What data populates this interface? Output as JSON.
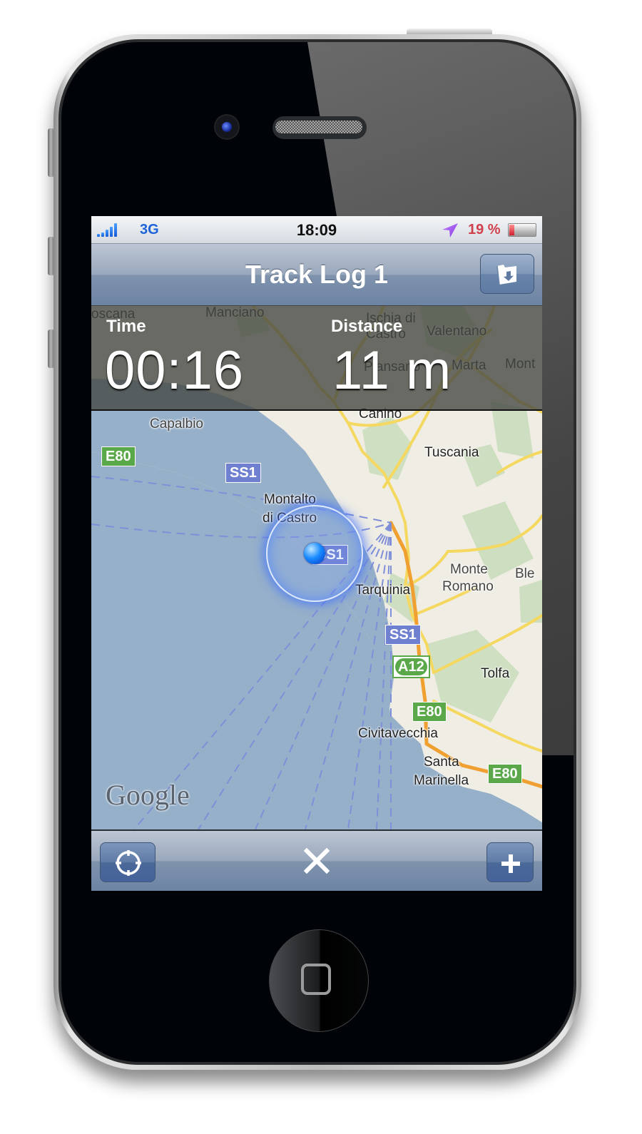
{
  "status_bar": {
    "carrier": "3G",
    "signal_bars": 5,
    "time": "18:09",
    "location_icon": "location-arrow-icon",
    "battery_percent_label": "19 %",
    "battery_level": 0.19
  },
  "nav_bar": {
    "title": "Track Log 1",
    "right_button_icon": "folder-download-icon"
  },
  "info_panel": {
    "time_label": "Time",
    "time_value": "00:16",
    "distance_label": "Distance",
    "distance_value": "11 m"
  },
  "map": {
    "provider_logo": "Google",
    "places": {
      "toscana": "oscana",
      "manciano": "Manciano",
      "ischia": "Ischia di",
      "castro": "Castro",
      "valentano": "Valentano",
      "piansano": "Piansano",
      "marta": "Marta",
      "mont": "Mont",
      "canino": "Canino",
      "capalbio": "Capalbio",
      "tuscania": "Tuscania",
      "montalto": "Montalto",
      "di_castro": "di Castro",
      "tarquinia": "Tarquinia",
      "monte": "Monte",
      "romano": "Romano",
      "ble": "Ble",
      "tolfa": "Tolfa",
      "civitavecchia": "Civitavecchia",
      "santa": "Santa",
      "marinella": "Marinella"
    },
    "shields": {
      "e80_west": "E80",
      "ss1_north": "SS1",
      "ss1_center": "SS1",
      "ss1_south": "SS1",
      "a12": "A12",
      "e80_civitavecchia": "E80",
      "e80_east": "E80"
    },
    "colors": {
      "sea": "#96b0ca",
      "land": "#f0ede4",
      "road": "#f4d860",
      "motorway": "#f0a030"
    }
  },
  "toolbar": {
    "locate_icon": "crosshair-icon",
    "close_icon": "close-icon",
    "add_icon": "plus-icon"
  }
}
